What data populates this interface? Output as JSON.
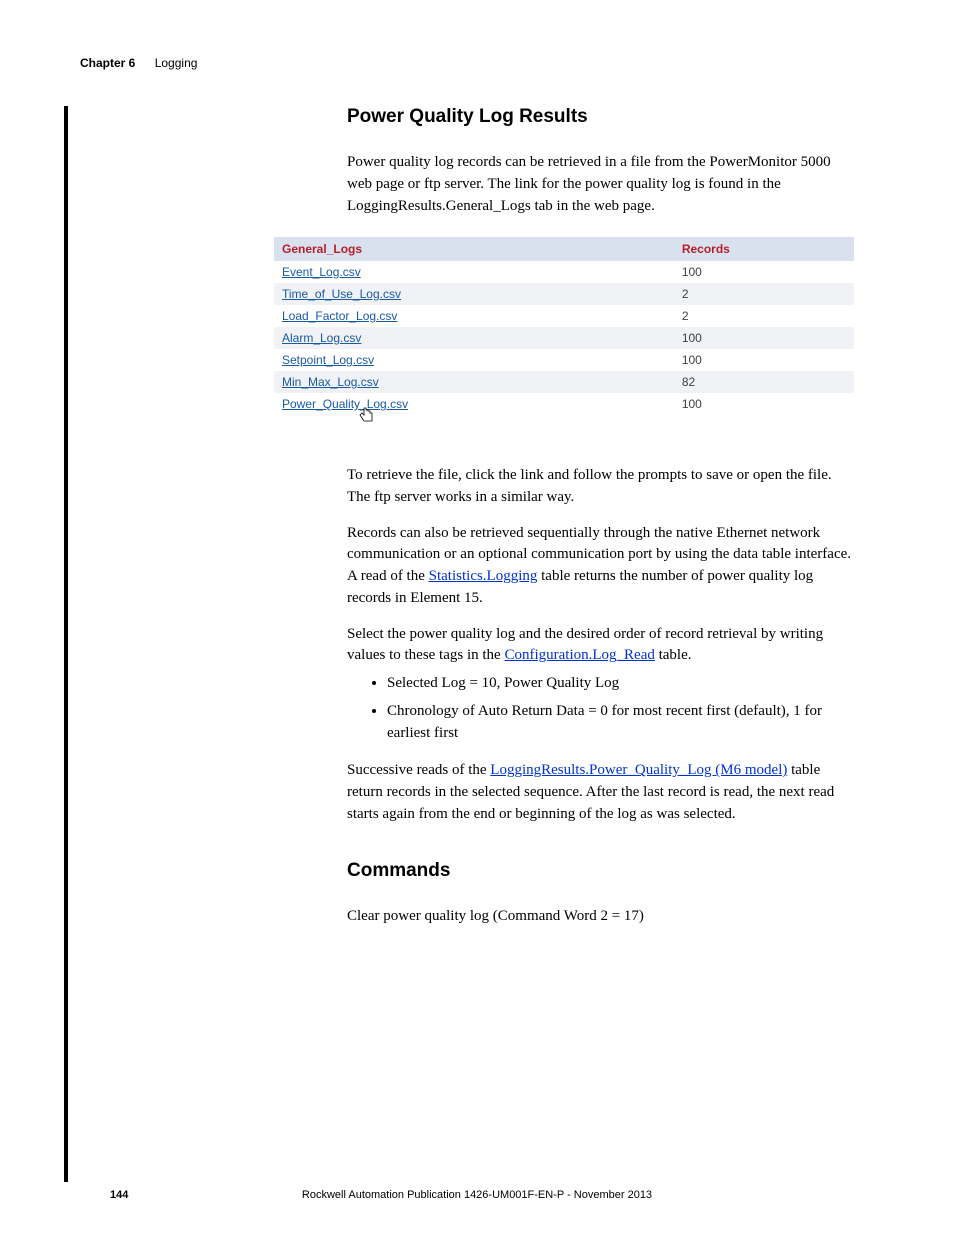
{
  "header": {
    "chapter_label": "Chapter 6",
    "chapter_title": "Logging"
  },
  "section1": {
    "title": "Power Quality Log Results",
    "para1": "Power quality log records can be retrieved in a file from the PowerMonitor 5000 web page or ftp server. The link for the power quality log is found in the LoggingResults.General_Logs tab in the web page."
  },
  "table": {
    "col1": "General_Logs",
    "col2": "Records",
    "rows": [
      {
        "name": "Event_Log.csv",
        "records": "100"
      },
      {
        "name": "Time_of_Use_Log.csv",
        "records": "2"
      },
      {
        "name": "Load_Factor_Log.csv",
        "records": "2"
      },
      {
        "name": "Alarm_Log.csv",
        "records": "100"
      },
      {
        "name": "Setpoint_Log.csv",
        "records": "100"
      },
      {
        "name": "Min_Max_Log.csv",
        "records": "82"
      },
      {
        "name": "Power_Quality_Log.csv",
        "records": "100"
      }
    ]
  },
  "lower": {
    "para2": "To retrieve the file, click the link and follow the prompts to save or open the file. The ftp server works in a similar way.",
    "para3a": "Records can also be retrieved sequentially through the native Ethernet network communication or an optional communication port by using the data table interface. A read of the ",
    "link1": "Statistics.Logging",
    "para3b": " table returns the number of power quality log records in Element 15.",
    "para4a": "Select the power quality log and the desired order of record retrieval by writing values to these tags in the ",
    "link2": "Configuration.Log_Read",
    "para4b": " table.",
    "bullet1": "Selected Log = 10, Power Quality Log",
    "bullet2": "Chronology of Auto Return Data = 0 for most recent first (default), 1 for earliest first",
    "para5a": "Successive reads of the ",
    "link3": "LoggingResults.Power_Quality_Log (M6 model)",
    "para5b": " table return records in the selected sequence. After the last record is read, the next read starts again from the end or beginning of the log as was selected."
  },
  "section2": {
    "title": "Commands",
    "para1": "Clear power quality log (Command Word 2 = 17)"
  },
  "footer": {
    "page_number": "144",
    "publication": "Rockwell Automation Publication 1426-UM001F-EN-P - November 2013"
  }
}
